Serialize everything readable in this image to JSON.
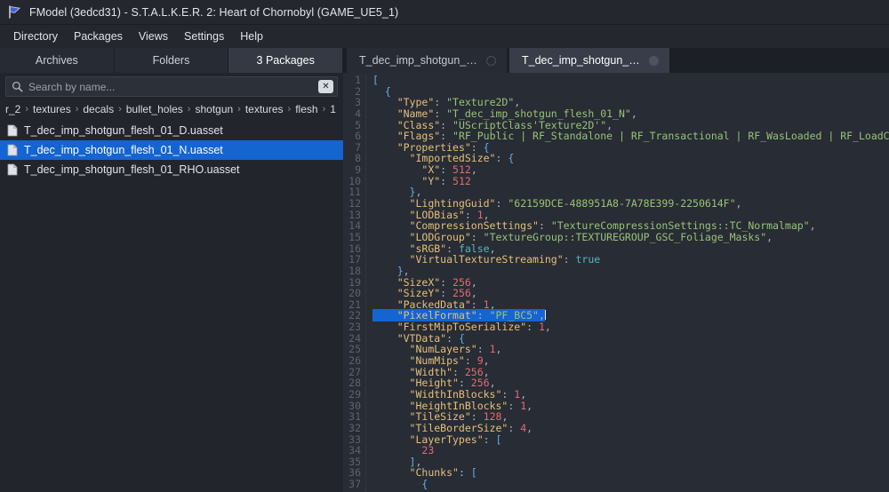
{
  "window": {
    "title": "FModel (3edcd31) - S.T.A.L.K.E.R. 2: Heart of Chornobyl (GAME_UE5_1)",
    "logo_icon": "fmodel-flag-icon"
  },
  "menubar": {
    "items": [
      {
        "label": "Directory"
      },
      {
        "label": "Packages"
      },
      {
        "label": "Views"
      },
      {
        "label": "Settings"
      },
      {
        "label": "Help"
      }
    ]
  },
  "left_panel": {
    "tabs": [
      {
        "label": "Archives",
        "active": false
      },
      {
        "label": "Folders",
        "active": false
      },
      {
        "label": "3 Packages",
        "active": true
      }
    ],
    "search": {
      "placeholder": "Search by name...",
      "value": "",
      "icon": "search-icon",
      "clear_icon": "clear-x-icon",
      "clear_label": "✕"
    },
    "breadcrumb": {
      "separator": "›",
      "crumbs": [
        "r_2",
        "textures",
        "decals",
        "bullet_holes",
        "shotgun",
        "textures",
        "flesh",
        "1"
      ]
    },
    "files": [
      {
        "name": "T_dec_imp_shotgun_flesh_01_D.uasset",
        "icon": "file-icon",
        "selected": false
      },
      {
        "name": "T_dec_imp_shotgun_flesh_01_N.uasset",
        "icon": "file-icon",
        "selected": true
      },
      {
        "name": "T_dec_imp_shotgun_flesh_01_RHO.uasset",
        "icon": "file-icon",
        "selected": false
      }
    ]
  },
  "editor": {
    "tabs": [
      {
        "label": "T_dec_imp_shotgun_flesh...",
        "active": false,
        "dot_icon": "tab-close-dot-icon"
      },
      {
        "label": "T_dec_imp_shotgun_flesh...",
        "active": true,
        "dot_icon": "tab-close-dot-icon"
      }
    ],
    "selected_line": 22,
    "first_line": 1,
    "last_line": 37,
    "lines": [
      {
        "n": 1,
        "tokens": [
          {
            "t": "[",
            "c": "p"
          }
        ]
      },
      {
        "n": 2,
        "tokens": [
          {
            "t": "  ",
            "c": "c"
          },
          {
            "t": "{",
            "c": "p"
          }
        ]
      },
      {
        "n": 3,
        "tokens": [
          {
            "t": "    ",
            "c": "c"
          },
          {
            "t": "\"Type\"",
            "c": "k"
          },
          {
            "t": ": ",
            "c": "c"
          },
          {
            "t": "\"Texture2D\"",
            "c": "s"
          },
          {
            "t": ",",
            "c": "c"
          }
        ]
      },
      {
        "n": 4,
        "tokens": [
          {
            "t": "    ",
            "c": "c"
          },
          {
            "t": "\"Name\"",
            "c": "k"
          },
          {
            "t": ": ",
            "c": "c"
          },
          {
            "t": "\"T_dec_imp_shotgun_flesh_01_N\"",
            "c": "s"
          },
          {
            "t": ",",
            "c": "c"
          }
        ]
      },
      {
        "n": 5,
        "tokens": [
          {
            "t": "    ",
            "c": "c"
          },
          {
            "t": "\"Class\"",
            "c": "k"
          },
          {
            "t": ": ",
            "c": "c"
          },
          {
            "t": "\"UScriptClass'Texture2D'\"",
            "c": "s"
          },
          {
            "t": ",",
            "c": "c"
          }
        ]
      },
      {
        "n": 6,
        "tokens": [
          {
            "t": "    ",
            "c": "c"
          },
          {
            "t": "\"Flags\"",
            "c": "k"
          },
          {
            "t": ": ",
            "c": "c"
          },
          {
            "t": "\"RF_Public | RF_Standalone | RF_Transactional | RF_WasLoaded | RF_LoadCompleted\"",
            "c": "s"
          },
          {
            "t": ",",
            "c": "c"
          }
        ]
      },
      {
        "n": 7,
        "tokens": [
          {
            "t": "    ",
            "c": "c"
          },
          {
            "t": "\"Properties\"",
            "c": "k"
          },
          {
            "t": ": ",
            "c": "c"
          },
          {
            "t": "{",
            "c": "p"
          }
        ]
      },
      {
        "n": 8,
        "tokens": [
          {
            "t": "      ",
            "c": "c"
          },
          {
            "t": "\"ImportedSize\"",
            "c": "k"
          },
          {
            "t": ": ",
            "c": "c"
          },
          {
            "t": "{",
            "c": "p"
          }
        ]
      },
      {
        "n": 9,
        "tokens": [
          {
            "t": "        ",
            "c": "c"
          },
          {
            "t": "\"X\"",
            "c": "k"
          },
          {
            "t": ": ",
            "c": "c"
          },
          {
            "t": "512",
            "c": "n"
          },
          {
            "t": ",",
            "c": "c"
          }
        ]
      },
      {
        "n": 10,
        "tokens": [
          {
            "t": "        ",
            "c": "c"
          },
          {
            "t": "\"Y\"",
            "c": "k"
          },
          {
            "t": ": ",
            "c": "c"
          },
          {
            "t": "512",
            "c": "n"
          }
        ]
      },
      {
        "n": 11,
        "tokens": [
          {
            "t": "      ",
            "c": "c"
          },
          {
            "t": "}",
            "c": "p"
          },
          {
            "t": ",",
            "c": "c"
          }
        ]
      },
      {
        "n": 12,
        "tokens": [
          {
            "t": "      ",
            "c": "c"
          },
          {
            "t": "\"LightingGuid\"",
            "c": "k"
          },
          {
            "t": ": ",
            "c": "c"
          },
          {
            "t": "\"62159DCE-488951A8-7A78E399-2250614F\"",
            "c": "s"
          },
          {
            "t": ",",
            "c": "c"
          }
        ]
      },
      {
        "n": 13,
        "tokens": [
          {
            "t": "      ",
            "c": "c"
          },
          {
            "t": "\"LODBias\"",
            "c": "k"
          },
          {
            "t": ": ",
            "c": "c"
          },
          {
            "t": "1",
            "c": "n"
          },
          {
            "t": ",",
            "c": "c"
          }
        ]
      },
      {
        "n": 14,
        "tokens": [
          {
            "t": "      ",
            "c": "c"
          },
          {
            "t": "\"CompressionSettings\"",
            "c": "k"
          },
          {
            "t": ": ",
            "c": "c"
          },
          {
            "t": "\"TextureCompressionSettings::TC_Normalmap\"",
            "c": "s"
          },
          {
            "t": ",",
            "c": "c"
          }
        ]
      },
      {
        "n": 15,
        "tokens": [
          {
            "t": "      ",
            "c": "c"
          },
          {
            "t": "\"LODGroup\"",
            "c": "k"
          },
          {
            "t": ": ",
            "c": "c"
          },
          {
            "t": "\"TextureGroup::TEXTUREGROUP_GSC_Foliage_Masks\"",
            "c": "s"
          },
          {
            "t": ",",
            "c": "c"
          }
        ]
      },
      {
        "n": 16,
        "tokens": [
          {
            "t": "      ",
            "c": "c"
          },
          {
            "t": "\"sRGB\"",
            "c": "k"
          },
          {
            "t": ": ",
            "c": "c"
          },
          {
            "t": "false",
            "c": "b"
          },
          {
            "t": ",",
            "c": "c"
          }
        ]
      },
      {
        "n": 17,
        "tokens": [
          {
            "t": "      ",
            "c": "c"
          },
          {
            "t": "\"VirtualTextureStreaming\"",
            "c": "k"
          },
          {
            "t": ": ",
            "c": "c"
          },
          {
            "t": "true",
            "c": "b"
          }
        ]
      },
      {
        "n": 18,
        "tokens": [
          {
            "t": "    ",
            "c": "c"
          },
          {
            "t": "}",
            "c": "p"
          },
          {
            "t": ",",
            "c": "c"
          }
        ]
      },
      {
        "n": 19,
        "tokens": [
          {
            "t": "    ",
            "c": "c"
          },
          {
            "t": "\"SizeX\"",
            "c": "k"
          },
          {
            "t": ": ",
            "c": "c"
          },
          {
            "t": "256",
            "c": "n"
          },
          {
            "t": ",",
            "c": "c"
          }
        ]
      },
      {
        "n": 20,
        "tokens": [
          {
            "t": "    ",
            "c": "c"
          },
          {
            "t": "\"SizeY\"",
            "c": "k"
          },
          {
            "t": ": ",
            "c": "c"
          },
          {
            "t": "256",
            "c": "n"
          },
          {
            "t": ",",
            "c": "c"
          }
        ]
      },
      {
        "n": 21,
        "tokens": [
          {
            "t": "    ",
            "c": "c"
          },
          {
            "t": "\"PackedData\"",
            "c": "k"
          },
          {
            "t": ": ",
            "c": "c"
          },
          {
            "t": "1",
            "c": "n"
          },
          {
            "t": ",",
            "c": "c"
          }
        ]
      },
      {
        "n": 22,
        "tokens": [
          {
            "t": "    ",
            "c": "c"
          },
          {
            "t": "\"PixelFormat\"",
            "c": "k"
          },
          {
            "t": ": ",
            "c": "c"
          },
          {
            "t": "\"PF_BC5\"",
            "c": "s"
          },
          {
            "t": ",",
            "c": "c"
          }
        ],
        "selected": true
      },
      {
        "n": 23,
        "tokens": [
          {
            "t": "    ",
            "c": "c"
          },
          {
            "t": "\"FirstMipToSerialize\"",
            "c": "k"
          },
          {
            "t": ": ",
            "c": "c"
          },
          {
            "t": "1",
            "c": "n"
          },
          {
            "t": ",",
            "c": "c"
          }
        ]
      },
      {
        "n": 24,
        "tokens": [
          {
            "t": "    ",
            "c": "c"
          },
          {
            "t": "\"VTData\"",
            "c": "k"
          },
          {
            "t": ": ",
            "c": "c"
          },
          {
            "t": "{",
            "c": "p"
          }
        ]
      },
      {
        "n": 25,
        "tokens": [
          {
            "t": "      ",
            "c": "c"
          },
          {
            "t": "\"NumLayers\"",
            "c": "k"
          },
          {
            "t": ": ",
            "c": "c"
          },
          {
            "t": "1",
            "c": "n"
          },
          {
            "t": ",",
            "c": "c"
          }
        ]
      },
      {
        "n": 26,
        "tokens": [
          {
            "t": "      ",
            "c": "c"
          },
          {
            "t": "\"NumMips\"",
            "c": "k"
          },
          {
            "t": ": ",
            "c": "c"
          },
          {
            "t": "9",
            "c": "n"
          },
          {
            "t": ",",
            "c": "c"
          }
        ]
      },
      {
        "n": 27,
        "tokens": [
          {
            "t": "      ",
            "c": "c"
          },
          {
            "t": "\"Width\"",
            "c": "k"
          },
          {
            "t": ": ",
            "c": "c"
          },
          {
            "t": "256",
            "c": "n"
          },
          {
            "t": ",",
            "c": "c"
          }
        ]
      },
      {
        "n": 28,
        "tokens": [
          {
            "t": "      ",
            "c": "c"
          },
          {
            "t": "\"Height\"",
            "c": "k"
          },
          {
            "t": ": ",
            "c": "c"
          },
          {
            "t": "256",
            "c": "n"
          },
          {
            "t": ",",
            "c": "c"
          }
        ]
      },
      {
        "n": 29,
        "tokens": [
          {
            "t": "      ",
            "c": "c"
          },
          {
            "t": "\"WidthInBlocks\"",
            "c": "k"
          },
          {
            "t": ": ",
            "c": "c"
          },
          {
            "t": "1",
            "c": "n"
          },
          {
            "t": ",",
            "c": "c"
          }
        ]
      },
      {
        "n": 30,
        "tokens": [
          {
            "t": "      ",
            "c": "c"
          },
          {
            "t": "\"HeightInBlocks\"",
            "c": "k"
          },
          {
            "t": ": ",
            "c": "c"
          },
          {
            "t": "1",
            "c": "n"
          },
          {
            "t": ",",
            "c": "c"
          }
        ]
      },
      {
        "n": 31,
        "tokens": [
          {
            "t": "      ",
            "c": "c"
          },
          {
            "t": "\"TileSize\"",
            "c": "k"
          },
          {
            "t": ": ",
            "c": "c"
          },
          {
            "t": "128",
            "c": "n"
          },
          {
            "t": ",",
            "c": "c"
          }
        ]
      },
      {
        "n": 32,
        "tokens": [
          {
            "t": "      ",
            "c": "c"
          },
          {
            "t": "\"TileBorderSize\"",
            "c": "k"
          },
          {
            "t": ": ",
            "c": "c"
          },
          {
            "t": "4",
            "c": "n"
          },
          {
            "t": ",",
            "c": "c"
          }
        ]
      },
      {
        "n": 33,
        "tokens": [
          {
            "t": "      ",
            "c": "c"
          },
          {
            "t": "\"LayerTypes\"",
            "c": "k"
          },
          {
            "t": ": ",
            "c": "c"
          },
          {
            "t": "[",
            "c": "p"
          }
        ]
      },
      {
        "n": 34,
        "tokens": [
          {
            "t": "        ",
            "c": "c"
          },
          {
            "t": "23",
            "c": "n"
          }
        ]
      },
      {
        "n": 35,
        "tokens": [
          {
            "t": "      ",
            "c": "c"
          },
          {
            "t": "]",
            "c": "p"
          },
          {
            "t": ",",
            "c": "c"
          }
        ]
      },
      {
        "n": 36,
        "tokens": [
          {
            "t": "      ",
            "c": "c"
          },
          {
            "t": "\"Chunks\"",
            "c": "k"
          },
          {
            "t": ": ",
            "c": "c"
          },
          {
            "t": "[",
            "c": "p"
          }
        ]
      },
      {
        "n": 37,
        "tokens": [
          {
            "t": "        ",
            "c": "c"
          },
          {
            "t": "{",
            "c": "p"
          }
        ]
      }
    ]
  },
  "colors": {
    "accent_selection": "#1464d2",
    "window_chrome": "#24272e",
    "panel_bg": "#22252c",
    "editor_bg": "#282c34",
    "key": "#e5c07b",
    "string": "#98c379",
    "number": "#e06c75",
    "boolean": "#56b6c2",
    "punctuation": "#61afef"
  }
}
